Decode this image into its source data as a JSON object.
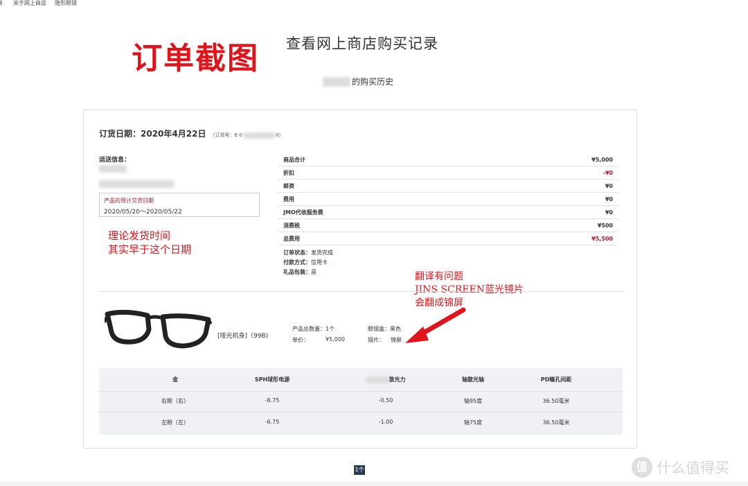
{
  "nav": {
    "items": [
      "者",
      "关于网上商店",
      "隐形眼镜"
    ]
  },
  "annotations": {
    "title": "订单截图",
    "ship_line1": "理论发货时间",
    "ship_line2": "其实早于这个日期",
    "trans_line1": "翻译有问题",
    "trans_line2": "JINS SCREEN蓝光镜片",
    "trans_line3": "会翻成锦屏",
    "arrow_color": "#e0141b"
  },
  "page": {
    "title": "查看网上商店购买记录",
    "history_suffix": "的购买历史"
  },
  "order": {
    "date_label": "订货日期：2020年4月22日",
    "order_no_prefix": "（订货号：E-0",
    "order_no_suffix": "8）",
    "shipping_label": "运送信息：",
    "delivery_label": "产品的预计交货日期",
    "delivery_value": "2020/05/20～2020/05/22"
  },
  "summary": {
    "rows": [
      {
        "label": "商品合计",
        "value": "¥5,000",
        "red": false
      },
      {
        "label": "折扣",
        "value": "-¥0",
        "red": true
      },
      {
        "label": "邮资",
        "value": "¥0",
        "red": false
      },
      {
        "label": "费用",
        "value": "¥0",
        "red": false
      },
      {
        "label": "JMO代收服务费",
        "value": "¥0",
        "red": false
      },
      {
        "label": "消费税",
        "value": "¥500",
        "red": false
      },
      {
        "label": "总费用",
        "value": "¥5,500",
        "red": true
      }
    ],
    "status_label": "订单状态：",
    "status_value": "发货完成",
    "payment_label": "付款方式：",
    "payment_value": "信用卡",
    "gift_label": "礼品包装：",
    "gift_value": "是"
  },
  "product": {
    "name": "[哑光机身]（99B)",
    "qty_label": "产品总数量：",
    "qty_value": "1个",
    "price_label": "单价：",
    "price_value": "¥5,000",
    "case_label": "眼镜盒：",
    "case_value": "黑色",
    "lens_label": "镜片：",
    "lens_value": "锦屏"
  },
  "rx": {
    "headers": [
      "金",
      "SPH球形电源",
      "散光力",
      "轴散光轴",
      "PD瞳孔间距"
    ],
    "rows": [
      {
        "eye": "右眼（右）",
        "sph": "-8.75",
        "cyl": "-0.50",
        "axis": "轴95度",
        "pd": "36.50毫米"
      },
      {
        "eye": "左眼（左）",
        "sph": "-6.75",
        "cyl": "-1.00",
        "axis": "轴75度",
        "pd": "36.50毫米"
      }
    ]
  },
  "pager": {
    "label": "1个"
  },
  "watermark": {
    "icon": "值",
    "text": "什么值得买"
  }
}
